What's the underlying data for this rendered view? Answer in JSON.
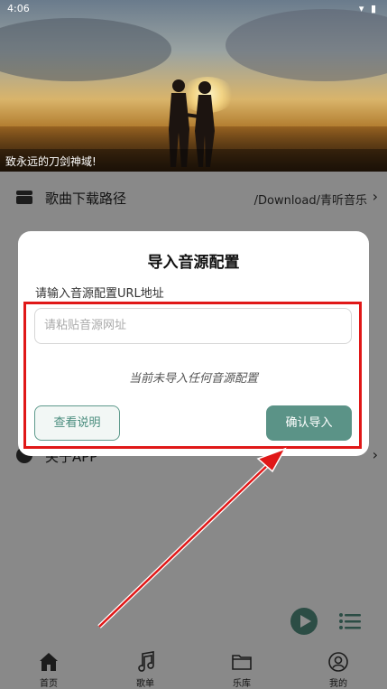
{
  "status_bar": {
    "time": "4:06",
    "icons": [
      "wifi-icon",
      "battery-icon"
    ]
  },
  "hero": {
    "caption": "致永远的刀剑神域!"
  },
  "settings_row": {
    "label": "歌曲下载路径",
    "value": "/Download/青听音乐"
  },
  "hidden_row_fragment": "关于APP",
  "dialog": {
    "title": "导入音源配置",
    "url_label": "请输入音源配置URL地址",
    "url_placeholder": "请粘贴音源网址",
    "url_value": "",
    "empty_status": "当前未导入任何音源配置",
    "help_button": "查看说明",
    "import_button": "确认导入"
  },
  "bottom_nav": {
    "items": [
      {
        "label": "首页",
        "icon": "home-icon"
      },
      {
        "label": "歌单",
        "icon": "music-note-icon"
      },
      {
        "label": "乐库",
        "icon": "folder-icon"
      },
      {
        "label": "我的",
        "icon": "user-icon"
      }
    ]
  },
  "colors": {
    "accent": "#5b9387",
    "highlight": "#e01818",
    "overlay": "#00000070"
  }
}
